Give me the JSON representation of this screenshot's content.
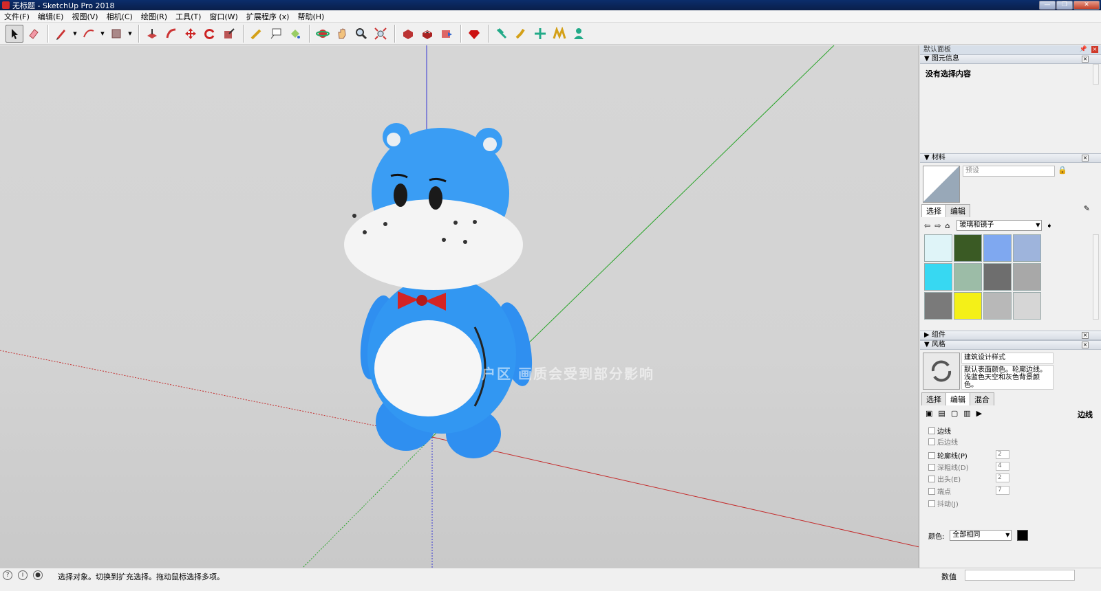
{
  "window": {
    "title": "无标题 - SketchUp Pro 2018",
    "controls": [
      "—",
      "❐",
      "✕"
    ]
  },
  "menu": [
    "文件(F)",
    "编辑(E)",
    "视图(V)",
    "相机(C)",
    "绘图(R)",
    "工具(T)",
    "窗口(W)",
    "扩展程序 (x)",
    "帮助(H)"
  ],
  "toolbar": {
    "tools": [
      "select-tool",
      "eraser-tool",
      "pencil-tool",
      "arc-tool",
      "rectangle-tool",
      "push-pull-tool",
      "follow-me-tool",
      "move-tool",
      "rotate-tool",
      "scale-tool",
      "tape-measure-tool",
      "text-tool",
      "paint-bucket-tool",
      "orbit-tool",
      "pan-tool",
      "zoom-tool",
      "zoom-extents-tool",
      "3d-warehouse-tool",
      "extension-warehouse-tool",
      "layout-tool",
      "ruby-tool",
      "sandbox-tool-1",
      "sandbox-tool-2",
      "sandbox-tool-3",
      "sandbox-tool-4",
      "sandbox-tool-5"
    ]
  },
  "viewport": {
    "watermark": "户区  画质会受到部分影响",
    "sky_color": "#d4d4d4"
  },
  "tray": {
    "title": "默认面板",
    "entity_info": {
      "header": "图元信息",
      "body": "没有选择内容"
    },
    "materials": {
      "header": "材料",
      "name_placeholder": "预设",
      "tabs": [
        "选择",
        "编辑"
      ],
      "library": "玻璃和镜子",
      "swatches": [
        "#dff4f8",
        "#3a5a24",
        "#7fa8f0",
        "#9eb4dc",
        "#37d8f2",
        "#9cbca7",
        "#6e6e6e",
        "#a8a8a8",
        "#7a7a7a",
        "#f4f018",
        "#b8b8b8",
        "#d6d6d6"
      ]
    },
    "components": {
      "header": "组件"
    },
    "styles": {
      "header": "风格",
      "name": "建筑设计样式",
      "description": "默认表面颜色。轮廓边线。浅蓝色天空和灰色背景颜色。",
      "tabs": [
        "选择",
        "编辑",
        "混合"
      ],
      "section": "边线",
      "options": [
        {
          "label": "边线",
          "enabled": true
        },
        {
          "label": "后边线",
          "enabled": false
        },
        {
          "label": "轮廓线(P)",
          "enabled": true,
          "value": "2"
        },
        {
          "label": "深粗线(D)",
          "enabled": false,
          "value": "4"
        },
        {
          "label": "出头(E)",
          "enabled": false,
          "value": "2"
        },
        {
          "label": "端点",
          "enabled": false,
          "value": "7"
        },
        {
          "label": "抖动(J)",
          "enabled": false
        }
      ],
      "color_label": "颜色:",
      "color_value": "全部相同",
      "color_chip": "#000000"
    }
  },
  "status": {
    "text": "选择对象。切换到扩充选择。拖动鼠标选择多项。",
    "vcb_label": "数值"
  }
}
